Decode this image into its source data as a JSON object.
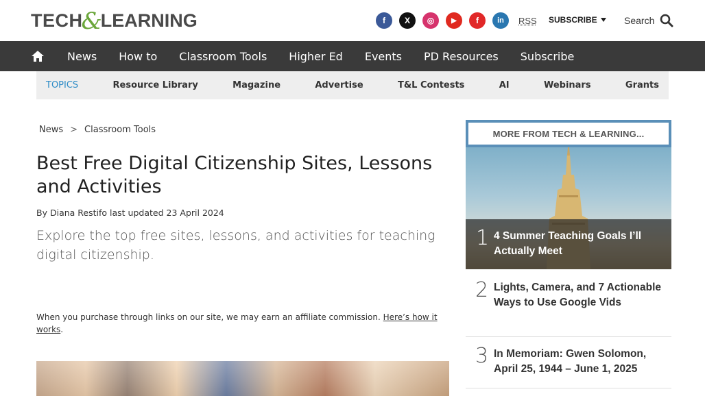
{
  "header": {
    "logo_part1": "TECH",
    "logo_amp": "&",
    "logo_part2": "LEARNING",
    "social": [
      {
        "name": "facebook-icon",
        "glyph": "f",
        "color": "#3b5998"
      },
      {
        "name": "x-icon",
        "glyph": "X",
        "color": "#111111"
      },
      {
        "name": "instagram-icon",
        "glyph": "◎",
        "color": "#d6336c"
      },
      {
        "name": "youtube-icon",
        "glyph": "▶",
        "color": "#e02a20"
      },
      {
        "name": "flipboard-icon",
        "glyph": "f",
        "color": "#e12828"
      },
      {
        "name": "linkedin-icon",
        "glyph": "in",
        "color": "#2a77b0"
      }
    ],
    "rss_label": "RSS",
    "subscribe_label": "SUBSCRIBE",
    "search_label": "Search"
  },
  "nav": {
    "items": [
      "News",
      "How to",
      "Classroom Tools",
      "Higher Ed",
      "Events",
      "PD Resources",
      "Subscribe"
    ]
  },
  "topics": {
    "label": "TOPICS",
    "items": [
      "Resource Library",
      "Magazine",
      "Advertise",
      "T&L Contests",
      "AI",
      "Webinars",
      "Grants"
    ]
  },
  "breadcrumb": {
    "items": [
      "News",
      "Classroom Tools"
    ],
    "separator": ">"
  },
  "article": {
    "title": "Best Free Digital Citizenship Sites, Lessons and Activities",
    "byline_prefix": "By",
    "author": "Diana Restifo",
    "updated_prefix": "last updated",
    "date": "23 April 2024",
    "standfirst": "Explore the top free sites, lessons, and activities for teaching digital citizenship.",
    "affiliate_text": "When you purchase through links on our site, we may earn an affiliate commission.",
    "affiliate_link": "Here’s how it works",
    "affiliate_end": "."
  },
  "sidebar": {
    "heading": "MORE FROM TECH & LEARNING...",
    "items": [
      {
        "num": "1",
        "title": "4 Summer Teaching Goals I’ll Actually Meet"
      },
      {
        "num": "2",
        "title": "Lights, Camera, and 7 Actionable Ways to Use Google Vids"
      },
      {
        "num": "3",
        "title": "In Memoriam: Gwen Solomon, April 25, 1944 – June 1, 2025"
      }
    ]
  }
}
